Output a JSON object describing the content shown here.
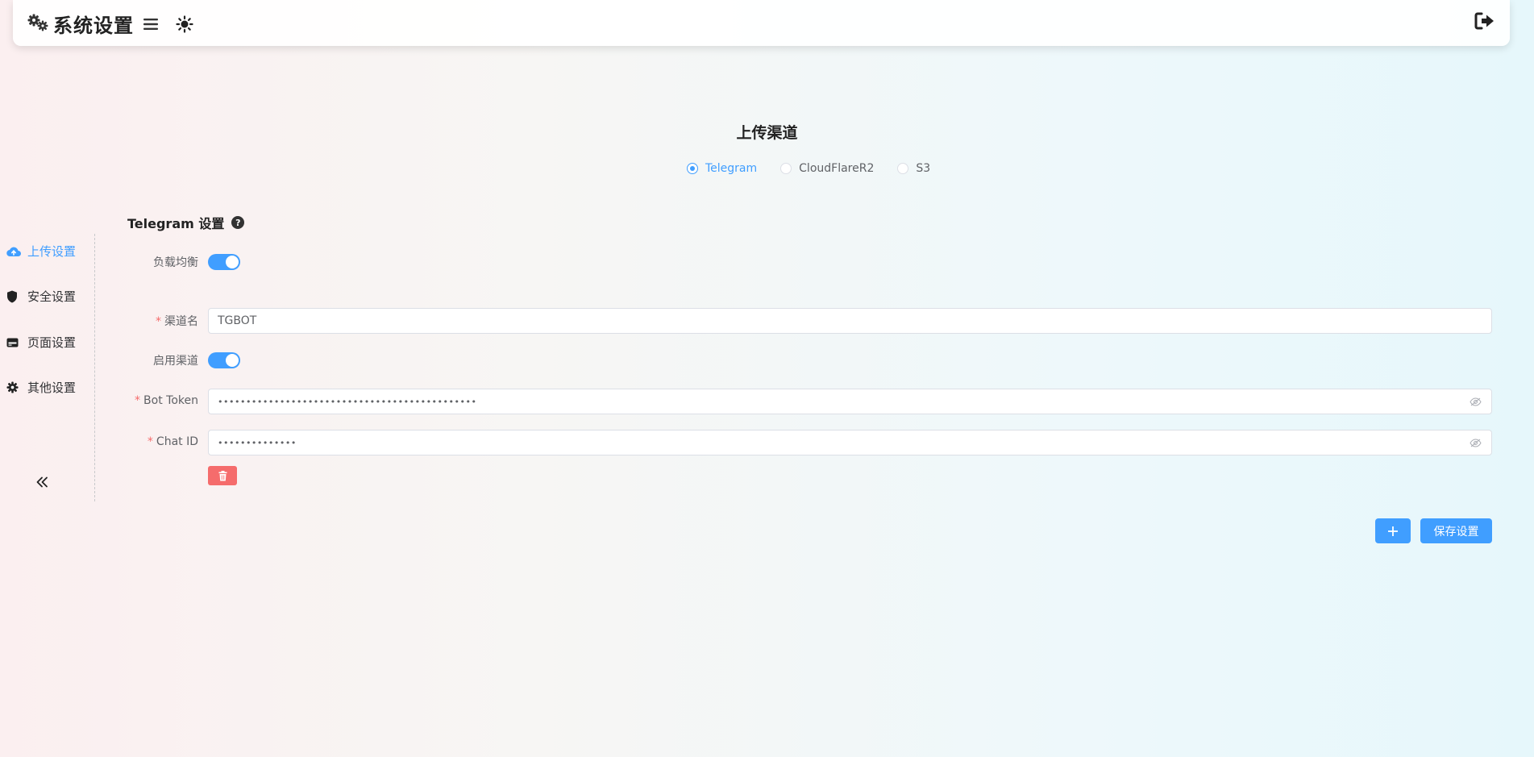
{
  "header": {
    "title": "系统设置",
    "icons": {
      "settings": "gears-icon",
      "menu": "hamburger-icon",
      "theme": "sun-icon",
      "logout": "logout-icon"
    }
  },
  "sidebar": {
    "items": [
      {
        "label": "上传设置",
        "icon": "cloud-upload-icon",
        "active": true
      },
      {
        "label": "安全设置",
        "icon": "shield-icon",
        "active": false
      },
      {
        "label": "页面设置",
        "icon": "card-icon",
        "active": false
      },
      {
        "label": "其他设置",
        "icon": "gear-icon",
        "active": false
      }
    ],
    "collapse_icon": "double-chevron-left-icon"
  },
  "main": {
    "section_title": "上传渠道",
    "channels": [
      {
        "label": "Telegram",
        "checked": true
      },
      {
        "label": "CloudFlareR2",
        "checked": false
      },
      {
        "label": "S3",
        "checked": false
      }
    ],
    "form_title": "Telegram 设置",
    "help_icon": "?",
    "fields": {
      "load_balance_label": "负载均衡",
      "load_balance_on": true,
      "channel_name_label": "渠道名",
      "channel_name_value": "TGBOT",
      "enable_channel_label": "启用渠道",
      "enable_channel_on": true,
      "bot_token_label": "Bot Token",
      "bot_token_value": "••••••••••••••••••••••••••••••••••••••••••••••",
      "chat_id_label": "Chat ID",
      "chat_id_value": "••••••••••••••"
    },
    "required_mark": "*",
    "buttons": {
      "add": "+",
      "save": "保存设置"
    }
  },
  "colors": {
    "accent": "#409eff",
    "danger": "#f56c6c"
  }
}
